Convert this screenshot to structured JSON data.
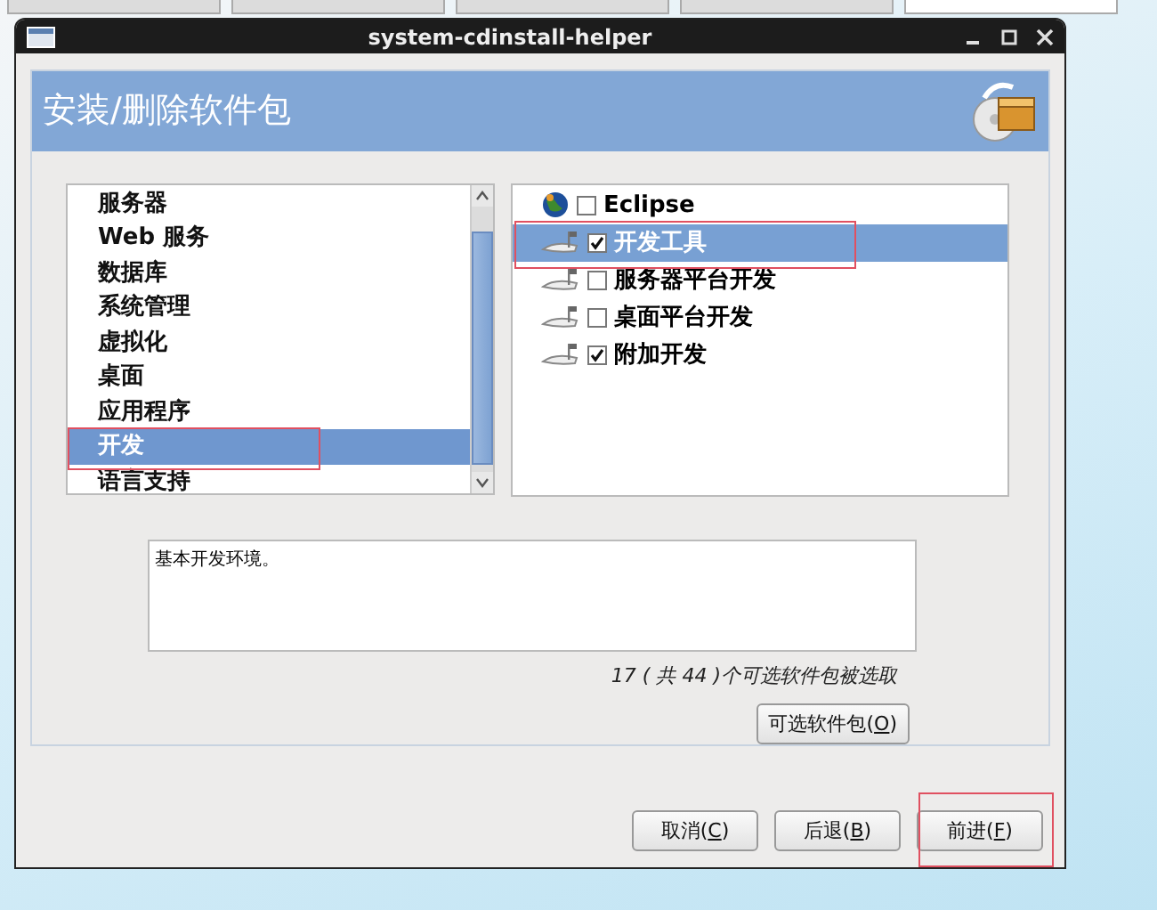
{
  "browser_tabs": [
    {
      "selected": false
    },
    {
      "selected": false
    },
    {
      "selected": false
    },
    {
      "selected": false
    },
    {
      "selected": true
    }
  ],
  "window": {
    "title": "system-cdinstall-helper"
  },
  "header": {
    "title": "安装/删除软件包"
  },
  "categories": [
    {
      "label": "服务器",
      "selected": false
    },
    {
      "label": "Web 服务",
      "selected": false
    },
    {
      "label": "数据库",
      "selected": false
    },
    {
      "label": "系统管理",
      "selected": false
    },
    {
      "label": "虚拟化",
      "selected": false
    },
    {
      "label": "桌面",
      "selected": false
    },
    {
      "label": "应用程序",
      "selected": false
    },
    {
      "label": "开发",
      "selected": true,
      "highlighted": true
    },
    {
      "label": "语言支持",
      "selected": false
    }
  ],
  "groups": [
    {
      "label": "Eclipse",
      "kind": "globe",
      "checked": false,
      "selected": false
    },
    {
      "label": "开发工具",
      "kind": "package",
      "checked": true,
      "selected": true,
      "highlighted": true
    },
    {
      "label": "服务器平台开发",
      "kind": "package",
      "checked": false,
      "selected": false
    },
    {
      "label": "桌面平台开发",
      "kind": "package",
      "checked": false,
      "selected": false
    },
    {
      "label": "附加开发",
      "kind": "package",
      "checked": true,
      "selected": false
    }
  ],
  "description": "基本开发环境。",
  "count_text": "17 ( 共 44 )个可选软件包被选取",
  "optional_button": {
    "before": "可选软件包(",
    "mnemonic": "O",
    "after": ")"
  },
  "buttons": [
    {
      "before": "取消(",
      "mnemonic": "C",
      "after": ")",
      "highlighted": false
    },
    {
      "before": "后退(",
      "mnemonic": "B",
      "after": ")",
      "highlighted": false
    },
    {
      "before": "前进(",
      "mnemonic": "F",
      "after": ")",
      "highlighted": true
    }
  ]
}
